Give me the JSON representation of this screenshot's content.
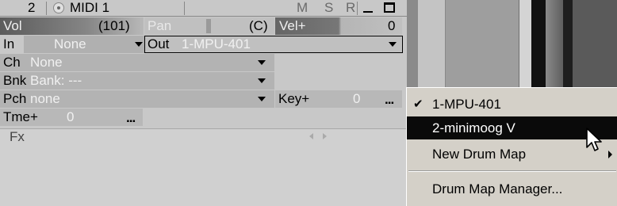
{
  "track": {
    "number": "2",
    "name": "MIDI 1",
    "buttons": {
      "mute": "M",
      "solo": "S",
      "record": "R"
    }
  },
  "params": {
    "vol_label": "Vol",
    "vol_value": "(101)",
    "pan_label": "Pan",
    "pan_value": "(C)",
    "vel_label": "Vel+",
    "vel_value": "0",
    "in_label": "In",
    "in_value": "None",
    "out_label": "Out",
    "out_value": "1-MPU-401",
    "ch_label": "Ch",
    "ch_value": "None",
    "bnk_label": "Bnk",
    "bnk_value": "Bank: ---",
    "pch_label": "Pch",
    "pch_value": "none",
    "key_label": "Key+",
    "key_value": "0",
    "tme_label": "Tme+",
    "tme_value": "0",
    "fx_label": "Fx",
    "more": "..."
  },
  "menu": {
    "items": [
      {
        "label": "1-MPU-401",
        "checked": true
      },
      {
        "label": "2-minimoog V",
        "highlighted": true
      },
      {
        "label": "New Drum Map",
        "submenu": true
      },
      {
        "label": "Drum Map Manager..."
      }
    ]
  }
}
